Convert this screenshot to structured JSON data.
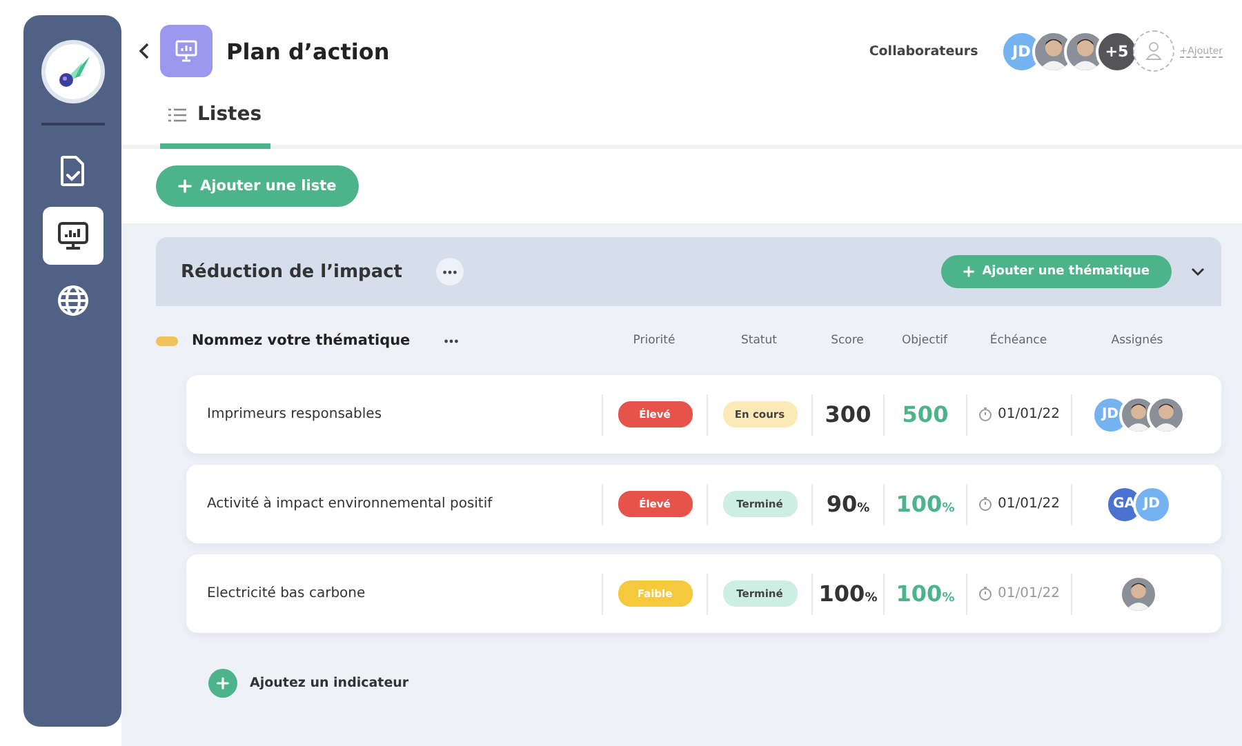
{
  "sidebar": {
    "items": [
      {
        "kind": "document",
        "selected": false
      },
      {
        "kind": "monitor",
        "selected": true
      },
      {
        "kind": "globe",
        "selected": false
      }
    ]
  },
  "header": {
    "title": "Plan d’action",
    "collaborators_label": "Collaborateurs",
    "collaborators": [
      {
        "kind": "initials",
        "text": "JD",
        "color": "#74b3f0"
      },
      {
        "kind": "photo"
      },
      {
        "kind": "photo"
      },
      {
        "kind": "count",
        "text": "+5",
        "color": "#545459"
      }
    ],
    "add_label": "+Ajouter"
  },
  "tabs": [
    {
      "label": "Listes",
      "selected": true
    }
  ],
  "add_list_button": "Ajouter une liste",
  "section": {
    "title": "Réduction de l’impact",
    "add_button": "Ajouter une thématique",
    "expanded": true,
    "theme": {
      "title": "Nommez votre thématique",
      "color": "#f0c35a"
    },
    "columns": [
      "Priorité",
      "Statut",
      "Score",
      "Objectif",
      "Échéance",
      "Assignés"
    ],
    "rows": [
      {
        "name": "Imprimeurs responsables",
        "priority": {
          "label": "Élevé",
          "color": "#e5534b"
        },
        "status": {
          "label": "En cours",
          "color": "#fbe9b7"
        },
        "score": {
          "value": "300"
        },
        "objective": {
          "value": "500"
        },
        "date": "01/01/22",
        "date_muted": false,
        "assignees": [
          {
            "kind": "initials",
            "text": "JD",
            "color": "#74b3f0"
          },
          {
            "kind": "photo"
          },
          {
            "kind": "photo"
          }
        ]
      },
      {
        "name": "Activité à impact environnemental positif",
        "priority": {
          "label": "Élevé",
          "color": "#e5534b"
        },
        "status": {
          "label": "Terminé",
          "color": "#cdeee3"
        },
        "score": {
          "value": "90",
          "unit": "%"
        },
        "objective": {
          "value": "100",
          "unit": "%"
        },
        "date": "01/01/22",
        "date_muted": false,
        "assignees": [
          {
            "kind": "initials",
            "text": "GA",
            "color": "#4a72d0"
          },
          {
            "kind": "initials",
            "text": "JD",
            "color": "#74b3f0"
          }
        ]
      },
      {
        "name": "Electricité bas carbone",
        "priority": {
          "label": "Faible",
          "color": "#f5c93b"
        },
        "status": {
          "label": "Terminé",
          "color": "#cdeee3"
        },
        "score": {
          "value": "100",
          "unit": "%"
        },
        "objective": {
          "value": "100",
          "unit": "%"
        },
        "date": "01/01/22",
        "date_muted": true,
        "assignees": [
          {
            "kind": "photo"
          }
        ]
      }
    ],
    "add_indicator": "Ajoutez un indicateur"
  }
}
